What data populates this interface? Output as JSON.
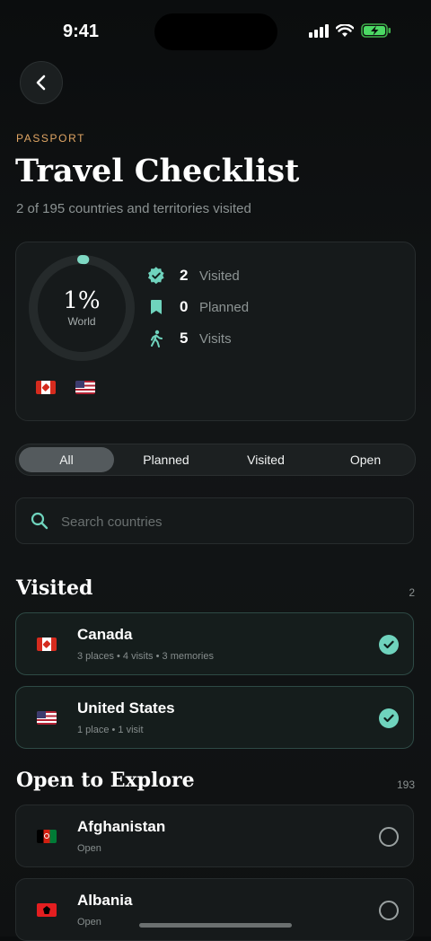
{
  "status_bar": {
    "time": "9:41"
  },
  "header": {
    "eyebrow": "PASSPORT",
    "title": "Travel Checklist",
    "subtitle": "2 of 195 countries and territories visited"
  },
  "summary": {
    "percent": "1%",
    "percent_value": 0.01,
    "percent_label": "World",
    "stats": [
      {
        "icon": "verified-badge-icon",
        "value": "2",
        "label": "Visited"
      },
      {
        "icon": "bookmark-icon",
        "value": "0",
        "label": "Planned"
      },
      {
        "icon": "walking-person-icon",
        "value": "5",
        "label": "Visits"
      }
    ],
    "flags": [
      "canada-flag-icon",
      "united-states-flag-icon"
    ]
  },
  "filters": {
    "options": [
      "All",
      "Planned",
      "Visited",
      "Open"
    ],
    "selected": "All"
  },
  "search": {
    "placeholder": "Search countries",
    "value": ""
  },
  "sections": {
    "visited": {
      "title": "Visited",
      "count": "2",
      "items": [
        {
          "name": "Canada",
          "meta": "3 places • 4 visits • 3 memories",
          "flag": "canada-flag-icon",
          "status": "visited"
        },
        {
          "name": "United States",
          "meta": "1 place • 1 visit",
          "flag": "united-states-flag-icon",
          "status": "visited"
        }
      ]
    },
    "open": {
      "title": "Open to Explore",
      "count": "193",
      "items": [
        {
          "name": "Afghanistan",
          "meta": "Open",
          "flag": "afghanistan-flag-icon",
          "status": "open"
        },
        {
          "name": "Albania",
          "meta": "Open",
          "flag": "albania-flag-icon",
          "status": "open"
        }
      ]
    }
  },
  "colors": {
    "accent": "#6fd3bd",
    "eyebrow": "#e0a664",
    "background": "#0f1112",
    "card": "#161a1b"
  }
}
